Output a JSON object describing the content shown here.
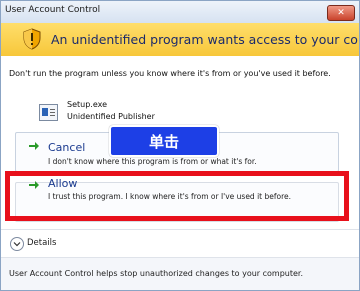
{
  "window": {
    "title": "User Account Control",
    "close_label": "✕"
  },
  "banner": {
    "text": "An unidentified program wants access to your computer"
  },
  "warning": {
    "text": "Don't run the program unless you know where it's from or you've used it before."
  },
  "program": {
    "name": "Setup.exe",
    "publisher": "Unidentified Publisher"
  },
  "options": {
    "cancel": {
      "title": "Cancel",
      "description": "I don't know where this program is from or what it's for."
    },
    "allow": {
      "title": "Allow",
      "description": "I trust this program. I know where it's from or I've used it before."
    }
  },
  "annotation": {
    "callout": "单击"
  },
  "details": {
    "label": "Details"
  },
  "footer": {
    "text": "User Account Control helps stop unauthorized changes to your computer."
  },
  "colors": {
    "banner": "#f7c73a",
    "highlight": "#e8101b",
    "callout": "#1d3fe6",
    "arrow": "#2a9a2a"
  }
}
